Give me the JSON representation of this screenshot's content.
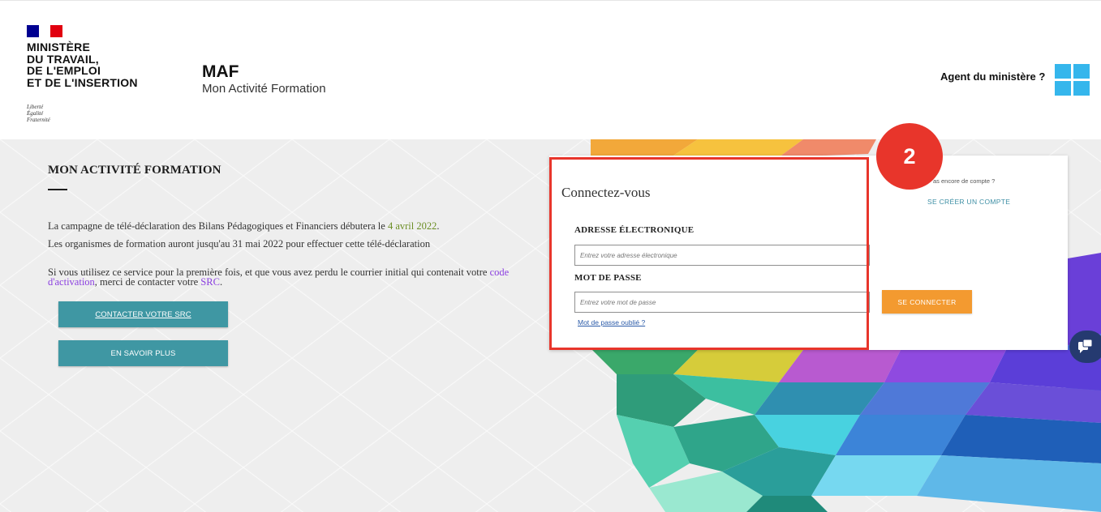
{
  "header": {
    "ministry_name": "MINISTÈRE\nDU TRAVAIL,\nDE L'EMPLOI\nET DE L'INSERTION",
    "devise": "Liberté\nÉgalité\nFraternité",
    "app_title": "MAF",
    "app_subtitle": "Mon Activité Formation",
    "agent_link": "Agent du ministère ?",
    "agent_icon": "windows-icon"
  },
  "intro": {
    "title": "MON ACTIVITÉ FORMATION",
    "campaign_text": "La campagne de télé-déclaration des Bilans Pédagogiques et Financiers débutera le",
    "campaign_date": "4 avril 2022",
    "campaign_end": ".",
    "deadline_text": "Les organismes de formation auront jusqu'au 31 mai 2022 pour effectuer cette télé-déclaration",
    "first_time_text": "Si vous utilisez ce service pour la première fois, et que vous avez perdu le courrier initial qui contenait votre",
    "activation_link": "code d'activation",
    "contact_text": ", merci de contacter votre",
    "src_link": "SRC",
    "final_dot": ".",
    "contact_button": "CONTACTER VOTRE SRC",
    "more_button": "EN SAVOIR PLUS"
  },
  "login": {
    "title": "Connectez-vous",
    "email_label": "ADRESSE ÉLECTRONIQUE",
    "email_placeholder": "Entrez votre adresse électronique",
    "password_label": "MOT DE PASSE",
    "password_placeholder": "Entrez votre mot de passe",
    "forgot_link": "Mot de passe oublié ?",
    "submit_button": "SE CONNECTER",
    "no_account_text": "as encore de compte ?",
    "create_account_link": "SE CRÉER UN COMPTE"
  },
  "annotation": {
    "step_number": "2",
    "color": "#e8352b"
  },
  "colors": {
    "teal": "#3f97a3",
    "orange": "#f39a30",
    "flag_blue": "#000091",
    "flag_red": "#e1000f"
  }
}
